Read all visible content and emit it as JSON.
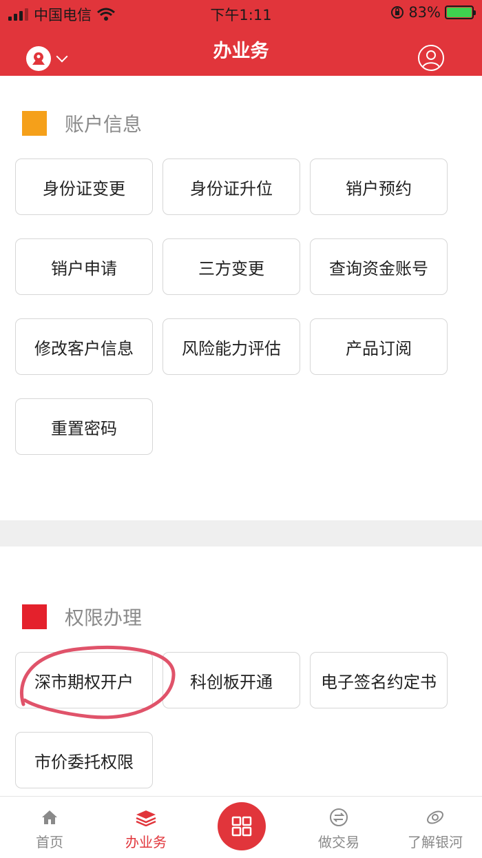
{
  "status": {
    "carrier": "中国电信",
    "time": "下午1:11",
    "battery": "83%"
  },
  "header": {
    "title": "办业务"
  },
  "sections": [
    {
      "title": "账户信息",
      "color": "#f5a01a",
      "items": [
        "身份证变更",
        "身份证升位",
        "销户预约",
        "销户申请",
        "三方变更",
        "查询资金账号",
        "修改客户信息",
        "风险能力评估",
        "产品订阅",
        "重置密码"
      ]
    },
    {
      "title": "权限办理",
      "color": "#e4212c",
      "items": [
        "深市期权开户",
        "科创板开通",
        "电子签名约定书",
        "市价委托权限"
      ]
    }
  ],
  "tabbar": {
    "items": [
      {
        "label": "首页",
        "icon": "home-icon"
      },
      {
        "label": "办业务",
        "icon": "layers-icon"
      },
      {
        "label": "",
        "icon": "grid-icon"
      },
      {
        "label": "做交易",
        "icon": "exchange-icon"
      },
      {
        "label": "了解银河",
        "icon": "galaxy-icon"
      }
    ],
    "active": "办业务"
  },
  "colors": {
    "brand": "#e1353b",
    "annotation": "#e0536a"
  }
}
